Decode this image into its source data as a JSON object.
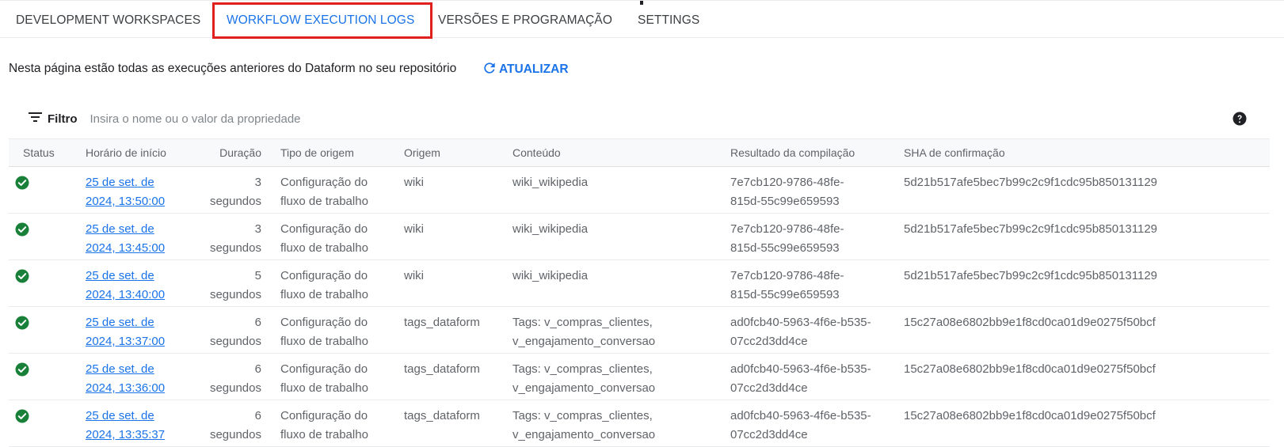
{
  "tabs": [
    {
      "label": "DEVELOPMENT WORKSPACES",
      "active": false
    },
    {
      "label": "WORKFLOW EXECUTION LOGS",
      "active": true
    },
    {
      "label": "VERSÕES E PROGRAMAÇÃO",
      "active": false
    },
    {
      "label": "SETTINGS",
      "active": false
    }
  ],
  "description": "Nesta página estão todas as execuções anteriores do Dataform no seu repositório",
  "refresh_label": "ATUALIZAR",
  "filter": {
    "label": "Filtro",
    "placeholder": "Insira o nome ou o valor da propriedade",
    "icon": "filter-icon"
  },
  "help_icon": "help-icon",
  "colors": {
    "accent": "#1a73e8",
    "success": "#188038",
    "highlight": "#e0201c"
  },
  "table": {
    "columns": [
      "Status",
      "Horário de início",
      "Duração",
      "Tipo de origem",
      "Origem",
      "Conteúdo",
      "Resultado da compilação",
      "SHA de confirmação"
    ],
    "rows": [
      {
        "status": "success",
        "start_line1": "25 de set. de",
        "start_line2": "2024, 13:50:00",
        "duration_value": "3",
        "duration_unit": "segundos",
        "source_type_line1": "Configuração do",
        "source_type_line2": "fluxo de trabalho",
        "source": "wiki",
        "content_line1": "wiki_wikipedia",
        "content_line2": "",
        "compilation_line1": "7e7cb120-9786-48fe-",
        "compilation_line2": "815d-55c99e659593",
        "sha": "5d21b517afe5bec7b99c2c9f1cdc95b850131129"
      },
      {
        "status": "success",
        "start_line1": "25 de set. de",
        "start_line2": "2024, 13:45:00",
        "duration_value": "3",
        "duration_unit": "segundos",
        "source_type_line1": "Configuração do",
        "source_type_line2": "fluxo de trabalho",
        "source": "wiki",
        "content_line1": "wiki_wikipedia",
        "content_line2": "",
        "compilation_line1": "7e7cb120-9786-48fe-",
        "compilation_line2": "815d-55c99e659593",
        "sha": "5d21b517afe5bec7b99c2c9f1cdc95b850131129"
      },
      {
        "status": "success",
        "start_line1": "25 de set. de",
        "start_line2": "2024, 13:40:00",
        "duration_value": "5",
        "duration_unit": "segundos",
        "source_type_line1": "Configuração do",
        "source_type_line2": "fluxo de trabalho",
        "source": "wiki",
        "content_line1": "wiki_wikipedia",
        "content_line2": "",
        "compilation_line1": "7e7cb120-9786-48fe-",
        "compilation_line2": "815d-55c99e659593",
        "sha": "5d21b517afe5bec7b99c2c9f1cdc95b850131129"
      },
      {
        "status": "success",
        "start_line1": "25 de set. de",
        "start_line2": "2024, 13:37:00",
        "duration_value": "6",
        "duration_unit": "segundos",
        "source_type_line1": "Configuração do",
        "source_type_line2": "fluxo de trabalho",
        "source": "tags_dataform",
        "content_line1": "Tags: v_compras_clientes,",
        "content_line2": "v_engajamento_conversao",
        "compilation_line1": "ad0fcb40-5963-4f6e-b535-",
        "compilation_line2": "07cc2d3dd4ce",
        "sha": "15c27a08e6802bb9e1f8cd0ca01d9e0275f50bcf"
      },
      {
        "status": "success",
        "start_line1": "25 de set. de",
        "start_line2": "2024, 13:36:00",
        "duration_value": "6",
        "duration_unit": "segundos",
        "source_type_line1": "Configuração do",
        "source_type_line2": "fluxo de trabalho",
        "source": "tags_dataform",
        "content_line1": "Tags: v_compras_clientes,",
        "content_line2": "v_engajamento_conversao",
        "compilation_line1": "ad0fcb40-5963-4f6e-b535-",
        "compilation_line2": "07cc2d3dd4ce",
        "sha": "15c27a08e6802bb9e1f8cd0ca01d9e0275f50bcf"
      },
      {
        "status": "success",
        "start_line1": "25 de set. de",
        "start_line2": "2024, 13:35:37",
        "duration_value": "6",
        "duration_unit": "segundos",
        "source_type_line1": "Configuração do",
        "source_type_line2": "fluxo de trabalho",
        "source": "tags_dataform",
        "content_line1": "Tags: v_compras_clientes,",
        "content_line2": "v_engajamento_conversao",
        "compilation_line1": "ad0fcb40-5963-4f6e-b535-",
        "compilation_line2": "07cc2d3dd4ce",
        "sha": "15c27a08e6802bb9e1f8cd0ca01d9e0275f50bcf"
      }
    ]
  }
}
